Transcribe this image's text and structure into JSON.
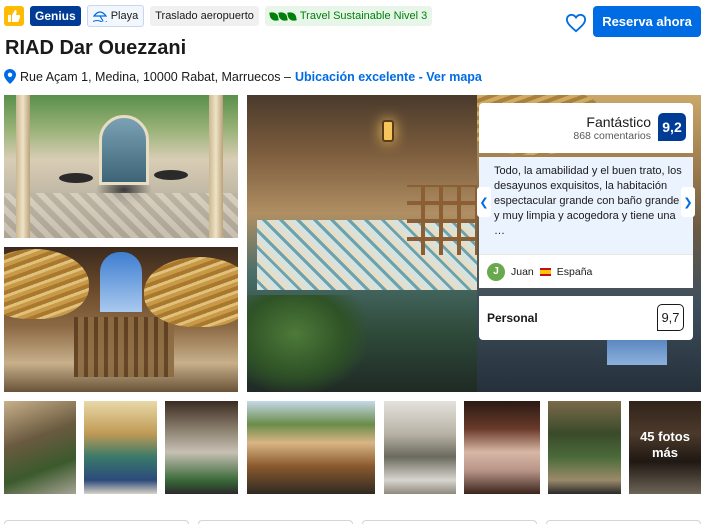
{
  "header": {
    "genius_label": "Genius",
    "beach_label": "Playa",
    "airport_label": "Traslado aeropuerto",
    "sustainable_label": "Travel Sustainable Nivel 3",
    "reserve_label": "Reserva ahora"
  },
  "property": {
    "name": "RIAD Dar Ouezzani",
    "address": "Rue Açam 1, Medina, 10000 Rabat, Marruecos –",
    "location_link": "Ubicación excelente - Ver mapa"
  },
  "review": {
    "rating_word": "Fantástico",
    "review_count": "868 comentarios",
    "score": "9,2",
    "quote": "Todo, la amabilidad y el buen trato, los desayunos exquisitos, la habitación espectacular grande con baño grande y muy limpia y acogedora y tiene una …",
    "reviewer_initial": "J",
    "reviewer_name": "Juan",
    "reviewer_country": "España",
    "staff_label": "Personal",
    "staff_score": "9,7"
  },
  "gallery": {
    "more_photos": "45 fotos más"
  },
  "colors": {
    "brand_blue": "#003b95",
    "action_blue": "#006ce4",
    "genius_yellow": "#febb02",
    "sustainable_green": "#008009"
  }
}
